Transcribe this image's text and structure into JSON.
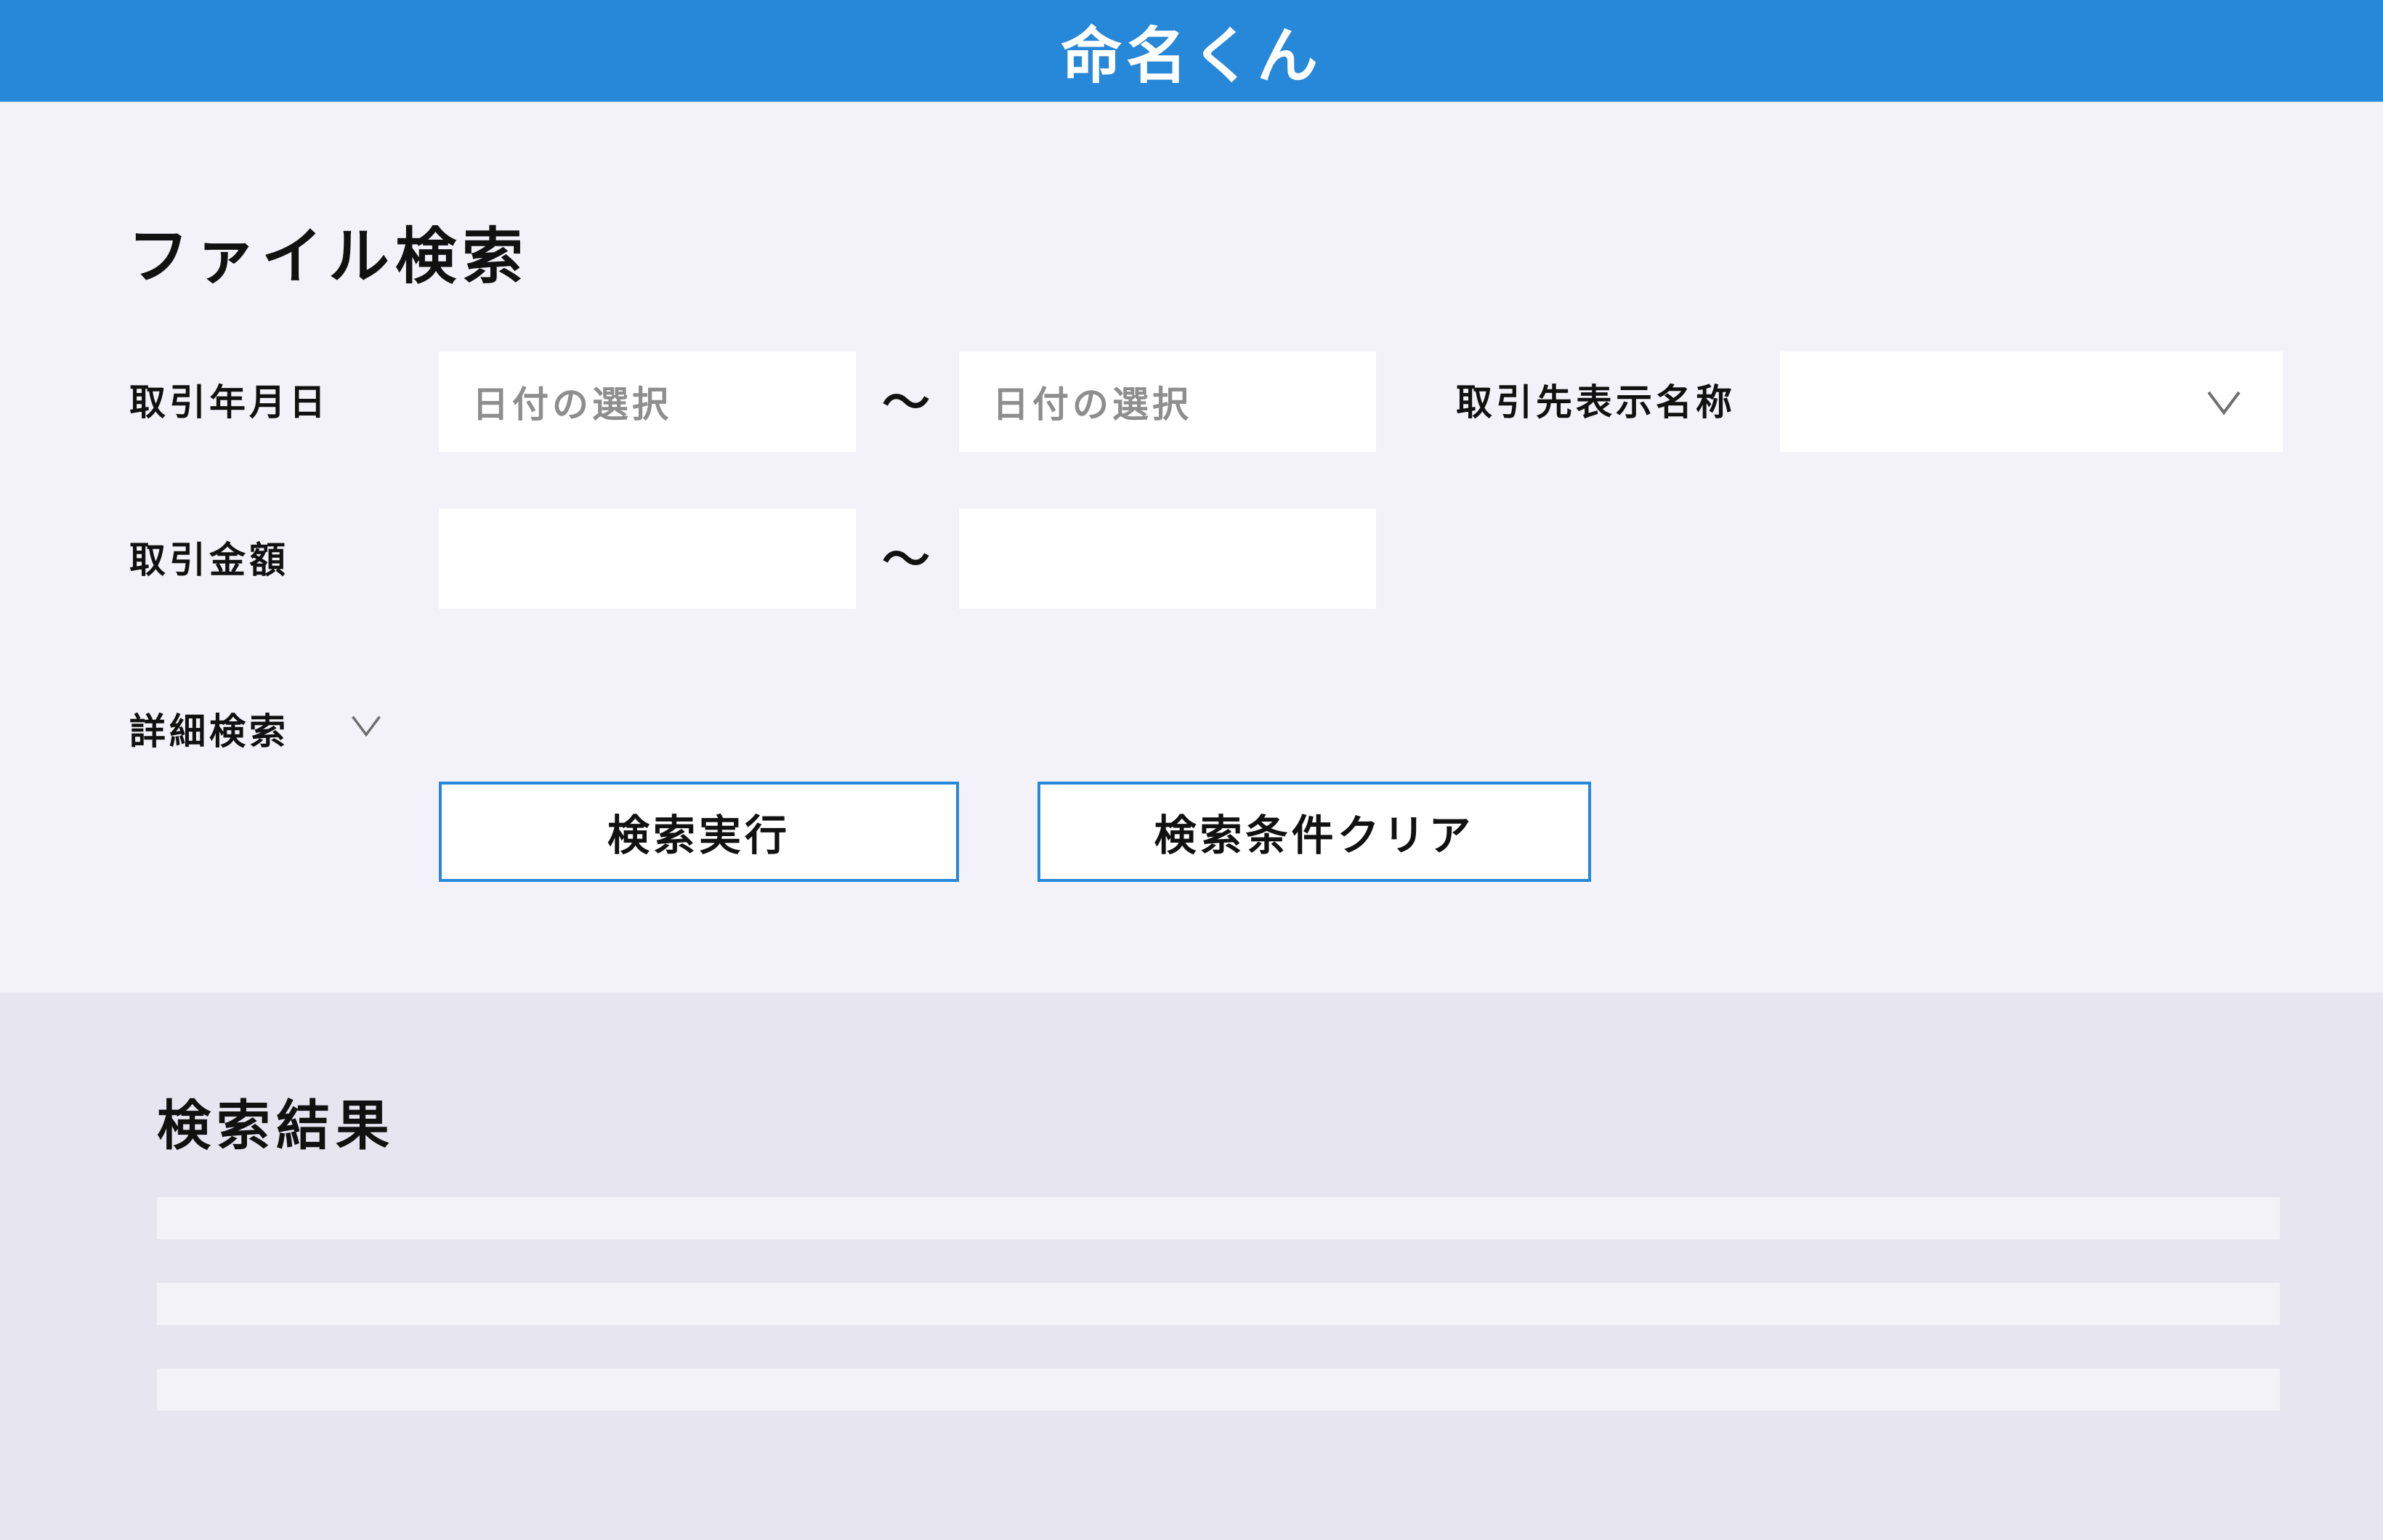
{
  "header": {
    "title": "命名くん",
    "color": "#2787d8"
  },
  "search": {
    "title": "ファイル検索",
    "date": {
      "label": "取引年月日",
      "from_placeholder": "日付の選択",
      "separator": "〜",
      "to_placeholder": "日付の選択"
    },
    "partner": {
      "label": "取引先表示名称",
      "value": "",
      "icon": "chevron-down-icon"
    },
    "amount": {
      "label": "取引金額",
      "separator": "〜",
      "from_value": "",
      "to_value": ""
    },
    "advanced": {
      "label": "詳細検索",
      "icon": "chevron-down-icon"
    },
    "buttons": {
      "execute": "検索実行",
      "clear": "検索条件クリア"
    }
  },
  "results": {
    "title": "検索結果",
    "rows": [
      "",
      "",
      ""
    ]
  }
}
